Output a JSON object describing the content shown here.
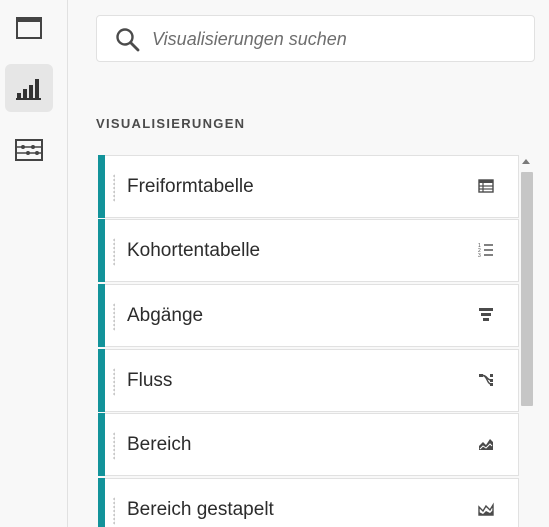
{
  "rail": {
    "buttons": [
      {
        "icon": "panel-icon",
        "active": false
      },
      {
        "icon": "visualizations-icon",
        "active": true
      },
      {
        "icon": "components-icon",
        "active": false
      }
    ]
  },
  "search": {
    "placeholder": "Visualisierungen suchen",
    "value": ""
  },
  "section": {
    "title": "VISUALISIERUNGEN"
  },
  "visualizations": [
    {
      "label": "Freiformtabelle",
      "icon": "table-icon"
    },
    {
      "label": "Kohortentabelle",
      "icon": "numbered-list-icon"
    },
    {
      "label": "Abgänge",
      "icon": "funnel-icon"
    },
    {
      "label": "Fluss",
      "icon": "flow-icon"
    },
    {
      "label": "Bereich",
      "icon": "area-chart-icon"
    },
    {
      "label": "Bereich gestapelt",
      "icon": "stacked-area-chart-icon"
    }
  ],
  "colors": {
    "accent": "#12939a",
    "active_rail": "#e6e6e6",
    "text": "#2c2c2c"
  }
}
